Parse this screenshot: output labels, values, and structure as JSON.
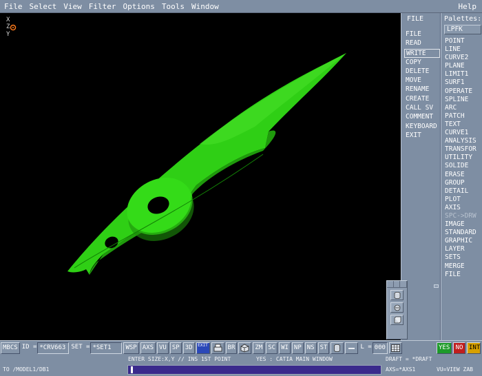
{
  "menubar": {
    "items": [
      "File",
      "Select",
      "View",
      "Filter",
      "Options",
      "Tools",
      "Window"
    ],
    "help": "Help"
  },
  "viewport": {
    "background": "#000000",
    "model_color": "#2fcf15",
    "axis_labels": {
      "x": "X",
      "z": "Z",
      "y": "Y"
    },
    "axis_marker_color": "#ff7a1a"
  },
  "function_panel": {
    "title": "FILE",
    "items": [
      "FILE",
      "READ",
      "WRITE",
      "COPY",
      "DELETE",
      "MOVE",
      "RENAME",
      "CREATE",
      "CALL SV",
      "COMMENT",
      "KEYBOARD",
      "EXIT"
    ],
    "selected": "WRITE"
  },
  "palettes": {
    "title": "Palettes:",
    "selected_palette": "LPFK",
    "items": [
      "POINT",
      "LINE",
      "CURVE2",
      "PLANE",
      "LIMIT1",
      "SURF1",
      "OPERATE",
      "SPLINE",
      "ARC",
      "PATCH",
      "TEXT",
      "CURVE1",
      "ANALYSIS",
      "TRANSFOR",
      "UTILITY",
      "SOLIDE",
      "ERASE",
      "GROUP",
      "DETAIL",
      "PLOT",
      "AXIS",
      "SPC->DRW",
      "IMAGE",
      "STANDARD",
      "GRAPHIC",
      "LAYER",
      "SETS",
      "MERGE",
      "FILE"
    ],
    "dimmed": "SPC->DRW"
  },
  "toolbar": {
    "mbcs": "MBCS",
    "id_label": "ID =",
    "id_value": "*CRV663",
    "set_label": "SET =",
    "set_value": "*SET1",
    "buttons": [
      "WSP",
      "AXS",
      "VU",
      "SP",
      "3D"
    ],
    "exit_label": "EXIT",
    "br": "BR",
    "buttons2": [
      "ZM",
      "SC",
      "WI",
      "NP",
      "NS",
      "ST"
    ],
    "l_label": "L =",
    "l_value": "000",
    "yes": "YES",
    "no": "NO",
    "int": "INT"
  },
  "status": {
    "prompt": "ENTER SIZE:X,Y // INS 1ST POINT",
    "window": "YES : CATIA MAIN WINDOW",
    "draft": "DRAFT = *DRAFT",
    "path": "TO /MODEL1/DB1",
    "axs": "AXS=*AXS1",
    "vu": "VU=VIEW ZAB"
  }
}
